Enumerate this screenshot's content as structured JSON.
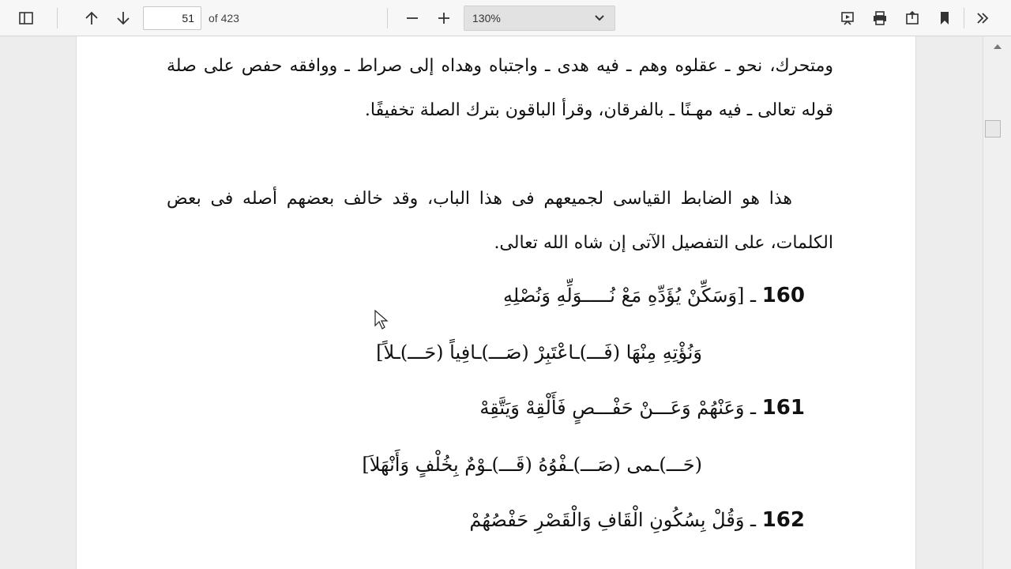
{
  "toolbar": {
    "page_number": "51",
    "page_total": "of 423",
    "zoom_level": "130%",
    "icons": [
      "sidebar-icon",
      "arrow-up-icon",
      "arrow-down-icon",
      "zoom-out-icon",
      "zoom-in-icon",
      "chevron-down-icon",
      "presentation-icon",
      "print-icon",
      "open-icon",
      "bookmark-icon",
      "double-chevron-right-icon"
    ]
  },
  "document": {
    "paragraph1": "ومتحرك، نحو ـ عقلوه وهم ـ فيه هدى ـ واجتباه وهداه إلى صراط ـ ووافقه حفص على صلة قوله تعالى ـ فيه مهـنًا ـ بالفرقان، وقرأ الباقون بترك الصلة تخفيفًا.",
    "paragraph2": "هذا هو الضابط القياسى لجميعهم فى هذا الباب، وقد خالف بعضهم أصله فى بعض الكلمات، على التفصيل الآتى إن شاه الله تعالى.",
    "verses": [
      {
        "number": "160",
        "text": "ـ [وَسَكِّنْ يُؤَدِّهِ مَعْ نُـــــوَلِّهِ وَنُصْلِهِ"
      },
      {
        "number": "",
        "text": "وَنُؤْتِهِ مِنْهَا (فَـــ)ـاعْتَبِرْ (صَـــ)ـافِياً (حَـــ)ـلاً]"
      },
      {
        "number": "161",
        "text": "ـ وَعَنْهُمْ وَعَـــنْ حَفْـــصٍ فَأَلْقِهْ وَيَتَّقِهْ"
      },
      {
        "number": "",
        "text": "(حَـــ)ـمى (صَـــ)ـفْوُهُ (قَـــ)ـوْمٌ بِخُلْفٍ وَأَنْهَلاَ]"
      },
      {
        "number": "162",
        "text": "ـ وَقُلْ بِسُكُونِ الْقَافِ وَالْقَصْرِ حَفْصُهُمْ"
      }
    ]
  }
}
